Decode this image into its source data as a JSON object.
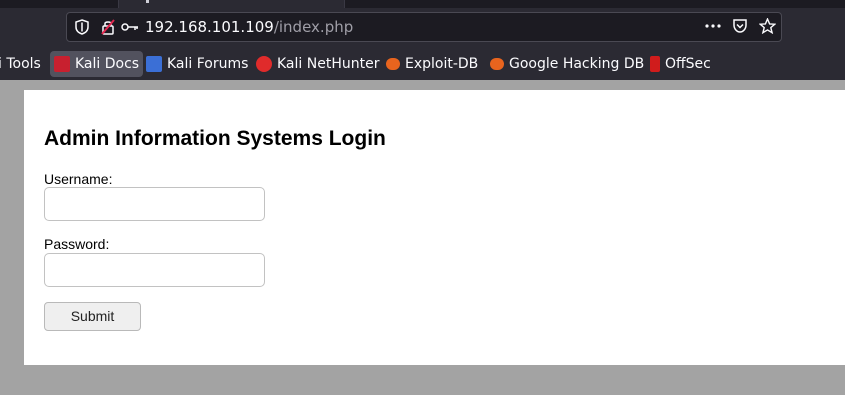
{
  "browser": {
    "url_host": "192.168.101.109",
    "url_path": "/index.php",
    "icons": {
      "shield": "shield-icon",
      "insecure_lock": "insecure-lock-icon",
      "key": "key-icon",
      "more": "more-actions-icon",
      "pocket": "pocket-icon",
      "bookmark_star": "star-icon"
    },
    "bookmarks": [
      {
        "label": "i Tools",
        "icon": "kali-tools-icon"
      },
      {
        "label": "Kali Docs",
        "icon": "kali-docs-icon",
        "active": true
      },
      {
        "label": "Kali Forums",
        "icon": "kali-forums-icon"
      },
      {
        "label": "Kali NetHunter",
        "icon": "kali-nethunter-icon"
      },
      {
        "label": "Exploit-DB",
        "icon": "exploit-db-icon"
      },
      {
        "label": "Google Hacking DB",
        "icon": "google-hacking-db-icon"
      },
      {
        "label": "OffSec",
        "icon": "offsec-icon"
      }
    ]
  },
  "login": {
    "title": "Admin Information Systems Login",
    "username_label": "Username:",
    "username_value": "",
    "password_label": "Password:",
    "password_value": "",
    "submit_label": "Submit"
  },
  "colors": {
    "chrome_bg": "#2b2a33",
    "page_bg": "#ffffff",
    "outer_bg": "#a3a3a3"
  }
}
